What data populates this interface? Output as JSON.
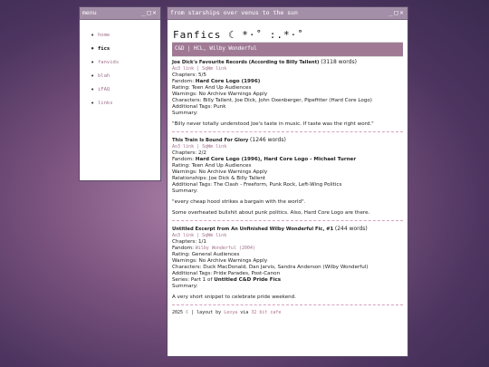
{
  "menu_window": {
    "title": "menu",
    "items": [
      {
        "label": "home",
        "active": false
      },
      {
        "label": "fics",
        "active": true
      },
      {
        "label": "fanvids",
        "active": false
      },
      {
        "label": "blah",
        "active": false
      },
      {
        "label": "iFAQ",
        "active": false
      },
      {
        "label": "links",
        "active": false
      }
    ]
  },
  "main_window": {
    "title": "from starships over venus to the sun",
    "page_title": "Fanfics ☾ *·˚ :.*·˚",
    "section_header": "C&D | HCL, Wilby Wonderful",
    "works": [
      {
        "title": "Joe Dick's Favourite Records (According to Billy Tallent)",
        "words": "(3118 words)",
        "links": "Ao3 link | SqWm link",
        "chapters": "Chapters: 5/5",
        "fandom_prefix": "Fandom: ",
        "fandom": "Hard Core Logo (1996)",
        "rating": "Rating: Teen And Up Audiences",
        "warnings": "Warnings: No Archive Warnings Apply",
        "characters": "Characters: Billy Tallent, Joe Dick, John Oxenberger, Pipefitter (Hard Core Logo)",
        "tags": "Additional Tags: Punk",
        "summary_label": "Summary:",
        "summary": "\"Billy never totally understood Joe's taste in music. If taste was the right word.\""
      },
      {
        "title": "This Train Is Bound For Glory",
        "words": "(1246 words)",
        "links": "Ao3 link | SqWm link",
        "chapters": "Chapters: 2/2",
        "fandom_prefix": "Fandom: ",
        "fandom": "Hard Core Logo (1996), Hard Core Logo - Michael Turner",
        "rating": "Rating: Teen And Up Audiences",
        "warnings": "Warnings: No Archive Warnings Apply",
        "relationships": "Relationships: Joe Dick & Billy Tallent",
        "tags": "Additional Tags: The Clash - Freeform, Punk Rock, Left-Wing Politics",
        "summary_label": "Summary:",
        "summary": "\"every cheap hood strikes a bargain with the world\".",
        "note": "Some overheated bullshit about punk politics. Also, Hard Core Logo are there."
      },
      {
        "title": "Untitled Excerpt from An Unfinished Wilby Wonderful Fic, #1",
        "words": "(244 words)",
        "links": "Ao3 link | SqWm link",
        "chapters": "Chapters: 1/1",
        "fandom_prefix": "Fandom: ",
        "fandom": "Wilby Wonderful (2004)",
        "rating": "Rating: General Audiences",
        "warnings": "Warnings: No Archive Warnings Apply",
        "characters": "Characters: Duck MacDonald, Dan Jarvis, Sandra Anderson (Wilby Wonderful)",
        "tags": "Additional Tags: Pride Parades, Post-Canon",
        "series_prefix": "Series: Part 1 of ",
        "series": "Untitled C&D Pride Fics",
        "summary_label": "Summary:",
        "summary": "A very short snippet to celebrate pride weekend."
      }
    ],
    "footer": {
      "prefix": "2025 ☾ | layout by ",
      "author": "Lexya",
      "via": " via ",
      "source": "32 bit cafe"
    }
  },
  "colors": {
    "titlebar": "#a48fa8",
    "section_bar": "#a07a95",
    "accent_link": "#a0708a"
  }
}
